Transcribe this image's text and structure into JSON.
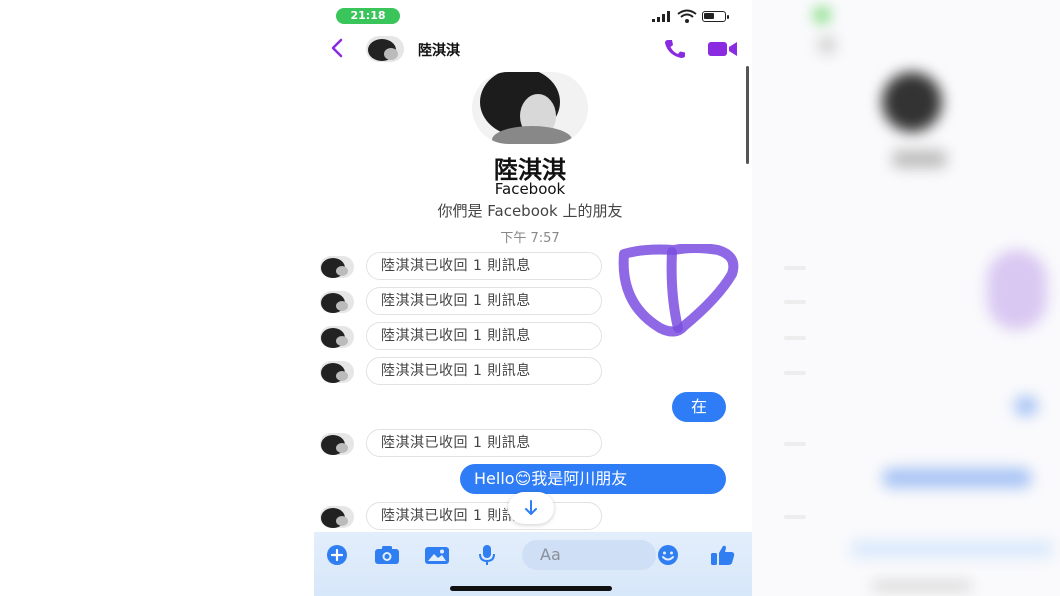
{
  "status_bar": {
    "time": "21:18"
  },
  "header": {
    "contact_name": "陸淇淇",
    "back_icon": "back-chevron-icon",
    "call_icon": "phone-icon",
    "video_icon": "video-camera-icon",
    "accent": "#8a2be2"
  },
  "profile": {
    "name": "陸淇淇",
    "platform": "Facebook",
    "relationship": "你們是 Facebook 上的朋友",
    "timestamp": "下午 7:57"
  },
  "messages": [
    {
      "type": "recalled",
      "text": "陸淇淇已收回 1 則訊息"
    },
    {
      "type": "recalled",
      "text": "陸淇淇已收回 1 則訊息"
    },
    {
      "type": "recalled",
      "text": "陸淇淇已收回 1 則訊息"
    },
    {
      "type": "recalled",
      "text": "陸淇淇已收回 1 則訊息"
    },
    {
      "type": "sent",
      "text": "在"
    },
    {
      "type": "recalled",
      "text": "陸淇淇已收回 1 則訊息"
    },
    {
      "type": "sent",
      "text_before": "Hello",
      "emoji": "😊",
      "text_after": "我是阿川朋友"
    },
    {
      "type": "recalled",
      "text": "陸淇淇已收回 1 則訊息"
    }
  ],
  "composer": {
    "placeholder": "Aa",
    "icons": [
      "plus-icon",
      "camera-icon",
      "gallery-icon",
      "microphone-icon",
      "emoji-icon",
      "thumbs-up-icon"
    ]
  },
  "colors": {
    "bubble_blue": "#2e7df6",
    "composer_blue": "#2f7ef2",
    "annotation_purple": "#7b4fe0"
  }
}
